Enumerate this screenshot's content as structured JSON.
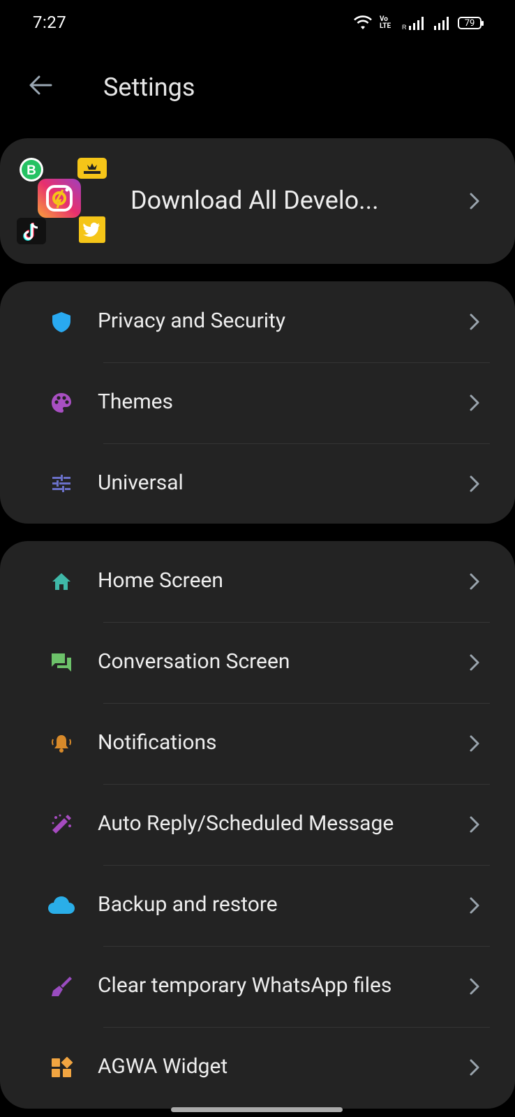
{
  "status": {
    "time": "7:27",
    "battery": "79"
  },
  "header": {
    "title": "Settings"
  },
  "promo": {
    "label": "Download All Develo..."
  },
  "groups": [
    {
      "items": [
        {
          "label": "Privacy and Security",
          "icon": "shield-icon",
          "color": "#29a9f0"
        },
        {
          "label": "Themes",
          "icon": "palette-icon",
          "color": "#a84fc2"
        },
        {
          "label": "Universal",
          "icon": "sliders-icon",
          "color": "#6a70c8"
        }
      ]
    },
    {
      "items": [
        {
          "label": "Home Screen",
          "icon": "home-icon",
          "color": "#3fb8a8"
        },
        {
          "label": "Conversation Screen",
          "icon": "chat-icon",
          "color": "#6dc26a"
        },
        {
          "label": "Notifications",
          "icon": "bell-icon",
          "color": "#d88a2a"
        },
        {
          "label": "Auto Reply/Scheduled Message",
          "icon": "magic-wand-icon",
          "color": "#a64bc0"
        },
        {
          "label": "Backup and restore",
          "icon": "cloud-icon",
          "color": "#2aaee8"
        },
        {
          "label": "Clear temporary WhatsApp files",
          "icon": "broom-icon",
          "color": "#9a4cc0"
        },
        {
          "label": "AGWA Widget",
          "icon": "widget-icon",
          "color": "#f2a541"
        }
      ]
    }
  ]
}
